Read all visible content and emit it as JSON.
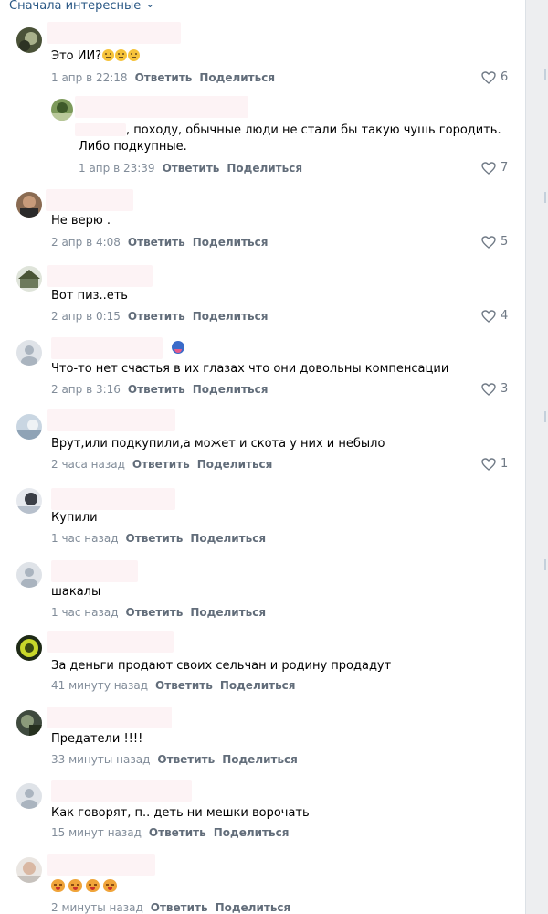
{
  "sort": {
    "label": "Сначала интересные"
  },
  "actions": {
    "reply": "Ответить",
    "share": "Поделиться"
  },
  "comments": [
    {
      "text_pre": "Это ИИ?",
      "time": "1 апр в 22:18",
      "likes": "6"
    },
    {
      "text_line1": ", походу, обычные люди не стали бы такую чушь городить.",
      "text_line2": "Либо подкупные.",
      "time": "1 апр в 23:39",
      "likes": "7"
    },
    {
      "text": "Не верю .",
      "time": "2 апр в 4:08",
      "likes": "5"
    },
    {
      "text": "Вот пиз..еть",
      "time": "2 апр в 0:15",
      "likes": "4"
    },
    {
      "text": "Что-то нет счастья в их глазах что они довольны компенсации",
      "time": "2 апр в 3:16",
      "likes": "3"
    },
    {
      "text": "Врут,или подкупили,а может и скота у них и небыло",
      "time": "2 часа назад",
      "likes": "1"
    },
    {
      "text": "Купили",
      "time": "1 час назад",
      "likes": ""
    },
    {
      "text": "шакалы",
      "time": "1 час назад",
      "likes": ""
    },
    {
      "text": "За деньги продают своих сельчан и родину продадут",
      "time": "41 минуту назад",
      "likes": ""
    },
    {
      "text": "Предатели !!!!",
      "time": "33 минуты назад",
      "likes": ""
    },
    {
      "text": "Как говорят, п.. деть ни мешки ворочать",
      "time": "15 минут назад",
      "likes": ""
    },
    {
      "text": "",
      "time": "2 минуты назад",
      "likes": ""
    }
  ]
}
